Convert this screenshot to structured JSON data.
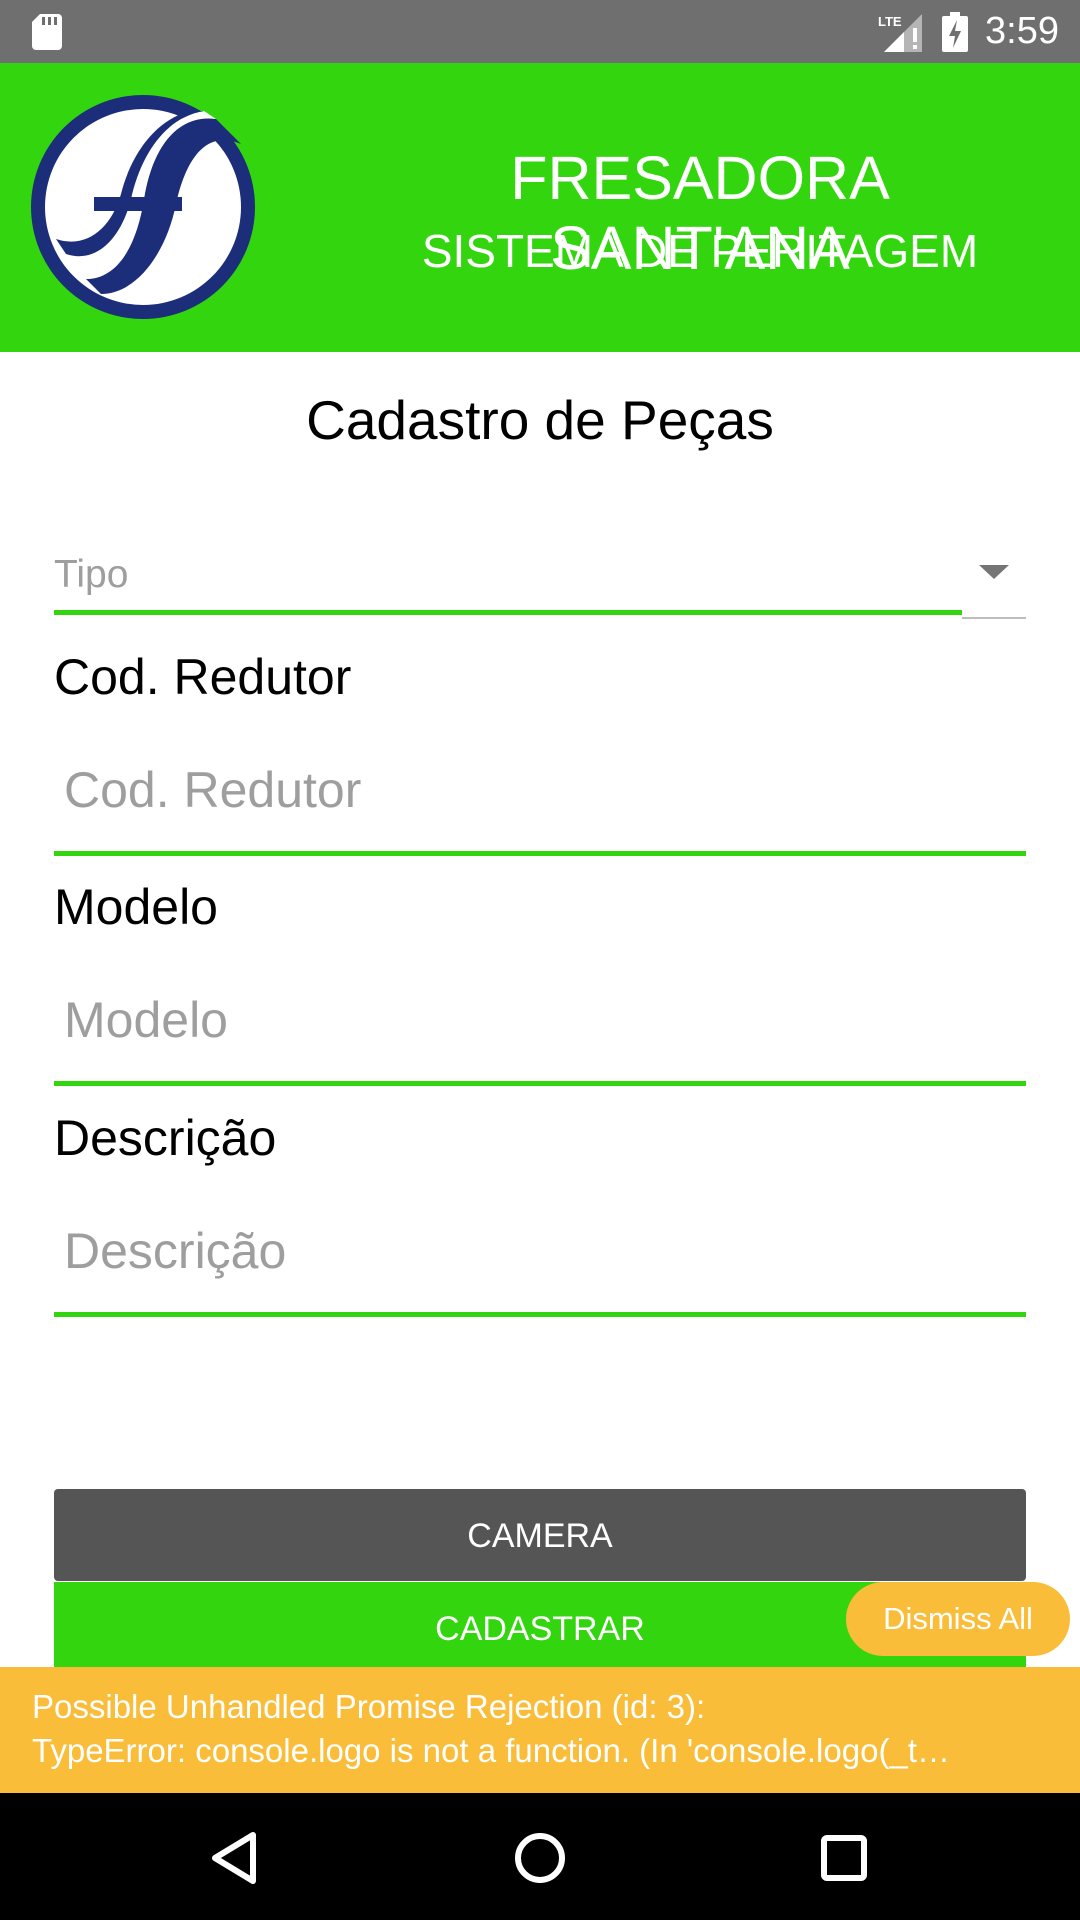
{
  "status_bar": {
    "time": "3:59",
    "icons": [
      "sd-card-icon",
      "lte-signal-icon",
      "battery-charging-icon"
    ]
  },
  "header": {
    "logo_icon": "fresadora-f-logo",
    "title": "FRESADORA SANT'ANA",
    "subtitle": "SISTEMA DE PERITAGEM",
    "background_color": "#33d60e"
  },
  "page": {
    "title": "Cadastro de Peças"
  },
  "form": {
    "tipo": {
      "placeholder": "Tipo",
      "arrow_icon": "dropdown-arrow-icon"
    },
    "fields": [
      {
        "label": "Cod. Redutor",
        "placeholder": "Cod. Redutor"
      },
      {
        "label": "Modelo",
        "placeholder": "Modelo"
      },
      {
        "label": "Descrição",
        "placeholder": "Descrição"
      }
    ],
    "accent_color": "#33d60e"
  },
  "buttons": {
    "camera": "CAMERA",
    "cadastrar": "CADASTRAR",
    "dismiss_all": "Dismiss All"
  },
  "warning": {
    "line1": "Possible Unhandled Promise Rejection (id: 3):",
    "line2": "TypeError: console.logo is not a function. (In 'console.logo(_t…",
    "color": "#f9bd3a"
  },
  "nav_bar": {
    "icons": [
      "back-icon",
      "home-icon",
      "recents-icon"
    ]
  }
}
